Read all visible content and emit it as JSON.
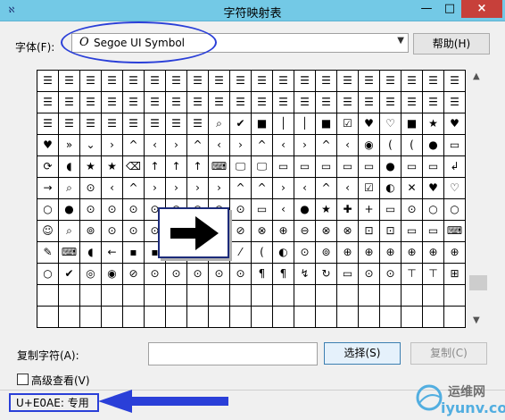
{
  "window": {
    "title": "字符映射表",
    "app_icon": "charmap-icon",
    "controls": {
      "minimize": "—",
      "maximize": "□",
      "close": "×"
    }
  },
  "font": {
    "label": "字体(F):",
    "selected": "Segoe UI Symbol",
    "icon_glyph": "O",
    "help_label": "帮助(H)"
  },
  "grid": {
    "columns": 20,
    "rows": [
      [
        "☰",
        "☰",
        "☰",
        "☰",
        "☰",
        "☰",
        "☰",
        "☰",
        "☰",
        "☰",
        "☰",
        "☰",
        "☰",
        "☰",
        "☰",
        "☰",
        "☰",
        "☰",
        "☰",
        "☰"
      ],
      [
        "☰",
        "☰",
        "☰",
        "☰",
        "☰",
        "☰",
        "☰",
        "☰",
        "☰",
        "☰",
        "☰",
        "☰",
        "☰",
        "☰",
        "☰",
        "☰",
        "☰",
        "☰",
        "☰",
        "☰"
      ],
      [
        "☰",
        "☰",
        "☰",
        "☰",
        "☰",
        "☰",
        "☰",
        "☰",
        "⌕",
        "✔",
        "■",
        "│",
        "│",
        "■",
        "☑",
        "♥",
        "♡",
        "■",
        "★",
        "♥"
      ],
      [
        "♥",
        "»",
        "⌄",
        "›",
        "^",
        "‹",
        "›",
        "^",
        "‹",
        "›",
        "^",
        "‹",
        "›",
        "^",
        "‹",
        "◉",
        "(",
        "(",
        "●",
        "▭"
      ],
      [
        "⟳",
        "◖",
        "★",
        "★",
        "⌫",
        "↑",
        "↑",
        "↑",
        "⌨",
        "🖵",
        "🖵",
        "▭",
        "▭",
        "▭",
        "▭",
        "▭",
        "●",
        "▭",
        "▭",
        "↲"
      ],
      [
        "→",
        "⌕",
        "⊙",
        "‹",
        "^",
        "›",
        "›",
        "›",
        "›",
        "^",
        "^",
        "›",
        "‹",
        "^",
        "‹",
        "☑",
        "◐",
        "✕",
        "♥",
        "♡"
      ],
      [
        "○",
        "●",
        "⊙",
        "⊙",
        "⊙",
        "⊙",
        "⊙",
        "⊙",
        "⊙",
        "⊙",
        "▭",
        "‹",
        "●",
        "★",
        "✚",
        "+",
        "▭",
        "⊙",
        "○",
        "○"
      ],
      [
        "☺",
        "⌕",
        "⊚",
        "⊙",
        "⊙",
        "⊙",
        "⊙",
        "·",
        "⊘",
        "⊘",
        "⊗",
        "⊕",
        "⊖",
        "⊗",
        "⊗",
        "⊡",
        "⊡",
        "▭",
        "▭",
        "⌨"
      ],
      [
        "✎",
        "⌨",
        "◖",
        "←",
        "▪",
        "▪",
        "⁄",
        "⁄",
        "⁄",
        "⁄",
        "(",
        "◐",
        "⊙",
        "⊚",
        "⊕",
        "⊕",
        "⊕",
        "⊕",
        "⊕",
        "⊕"
      ],
      [
        "○",
        "✔",
        "◎",
        "◉",
        "⊘",
        "⊙",
        "⊙",
        "⊙",
        "⊙",
        "⊙",
        "¶",
        "¶",
        "↯",
        "↻",
        "▭",
        "⊙",
        "⊙",
        "⊤",
        "⊤",
        "⊞"
      ],
      [
        "",
        "",
        "",
        "",
        "",
        "",
        "",
        "",
        "",
        "",
        "",
        "",
        "",
        "",
        "",
        "",
        "",
        "",
        "",
        ""
      ],
      [
        "",
        "",
        "",
        "",
        "",
        "",
        "",
        "",
        "",
        "",
        "",
        "",
        "",
        "",
        "",
        "",
        "",
        "",
        "",
        ""
      ]
    ]
  },
  "copy": {
    "label": "复制字符(A):",
    "value": "",
    "select_label": "选择(S)",
    "copy_label": "复制(C)"
  },
  "advanced": {
    "label": "高级查看(V)",
    "checked": false
  },
  "status": {
    "text": "U+E0AE: 专用"
  },
  "watermark": {
    "line1": "运维网",
    "line2": "iyunv.com"
  },
  "colors": {
    "titlebar": "#73c9e6",
    "annotation_blue": "#2a3fd8",
    "close_red": "#c7403a"
  }
}
